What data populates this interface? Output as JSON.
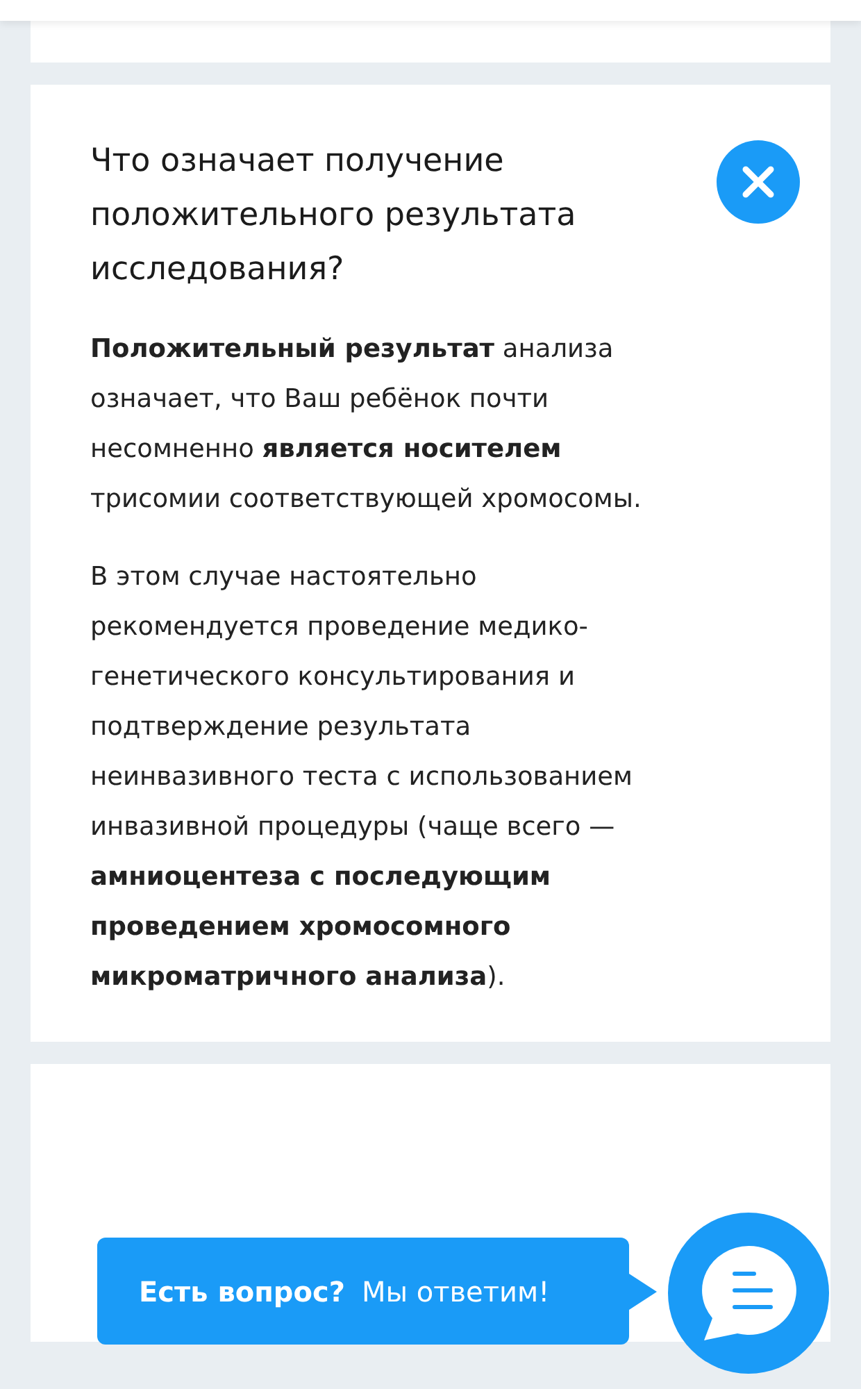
{
  "faq_item": {
    "question": "Что означает получение положительного результата исследования?",
    "expanded": true,
    "paragraphs": [
      "**Положительный результат** анализа означает, что Ваш ребёнок почти несомненно **является носителем** трисомии соответствующей хромосомы.",
      "В этом случае настоятельно рекомендуется проведение медико-генетического консультирования и подтверждение результата неинвазивного теста с использованием инвазивной процедуры (чаще всего — **амниоцентеза с последующим проведением хромосомного микроматричного анализа**)."
    ]
  },
  "chat_prompt": {
    "title": "Есть вопрос?",
    "text": "Мы ответим!"
  }
}
